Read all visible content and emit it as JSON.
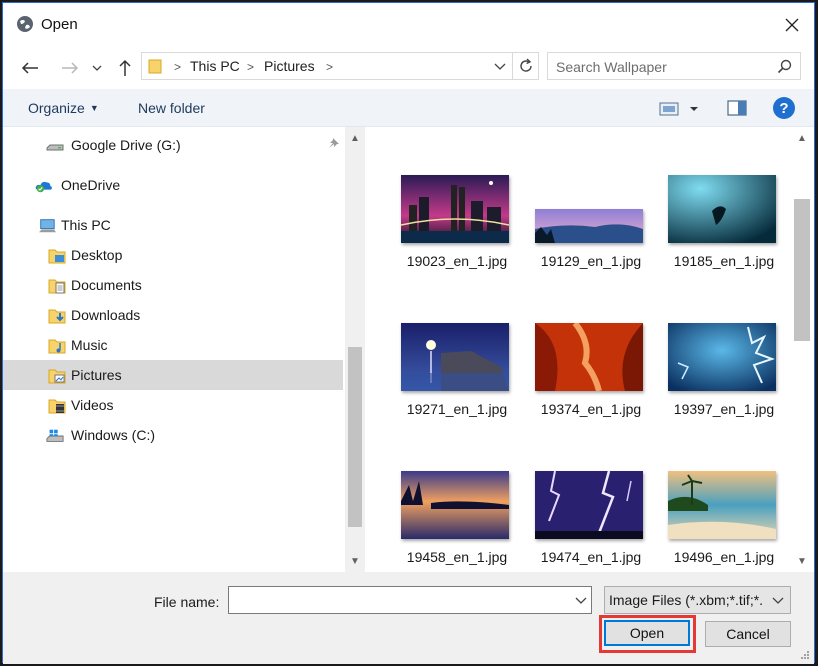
{
  "window": {
    "title": "Open",
    "close_symbol": "✕"
  },
  "address": {
    "crumbs": [
      "This PC",
      "Pictures"
    ],
    "separator": ">"
  },
  "search": {
    "placeholder": "Search Wallpaper"
  },
  "toolbar": {
    "organize_label": "Organize",
    "new_folder_label": "New folder",
    "help_symbol": "?"
  },
  "nav": {
    "items": [
      {
        "label": "Google Drive (G:)",
        "icon": "drive-icon"
      },
      {
        "label": "OneDrive",
        "icon": "onedrive-icon"
      },
      {
        "label": "This PC",
        "icon": "computer-icon"
      },
      {
        "label": "Desktop",
        "icon": "desktop-folder-icon"
      },
      {
        "label": "Documents",
        "icon": "documents-folder-icon"
      },
      {
        "label": "Downloads",
        "icon": "downloads-folder-icon"
      },
      {
        "label": "Music",
        "icon": "music-folder-icon"
      },
      {
        "label": "Pictures",
        "icon": "pictures-folder-icon"
      },
      {
        "label": "Videos",
        "icon": "videos-folder-icon"
      },
      {
        "label": "Windows (C:)",
        "icon": "windows-drive-icon"
      }
    ],
    "selected": "Pictures"
  },
  "files": [
    {
      "name": "19023_en_1.jpg"
    },
    {
      "name": "19129_en_1.jpg"
    },
    {
      "name": "19185_en_1.jpg"
    },
    {
      "name": "19271_en_1.jpg"
    },
    {
      "name": "19374_en_1.jpg"
    },
    {
      "name": "19397_en_1.jpg"
    },
    {
      "name": "19458_en_1.jpg"
    },
    {
      "name": "19474_en_1.jpg"
    },
    {
      "name": "19496_en_1.jpg"
    }
  ],
  "footer": {
    "file_name_label": "File name:",
    "file_name_value": "",
    "file_type_value": "Image Files (*.xbm;*.tif;*.",
    "open_label": "Open",
    "cancel_label": "Cancel"
  },
  "colors": {
    "accent": "#0078d7",
    "highlight_box": "#e53935",
    "selected_nav": "#d9d9d9"
  }
}
